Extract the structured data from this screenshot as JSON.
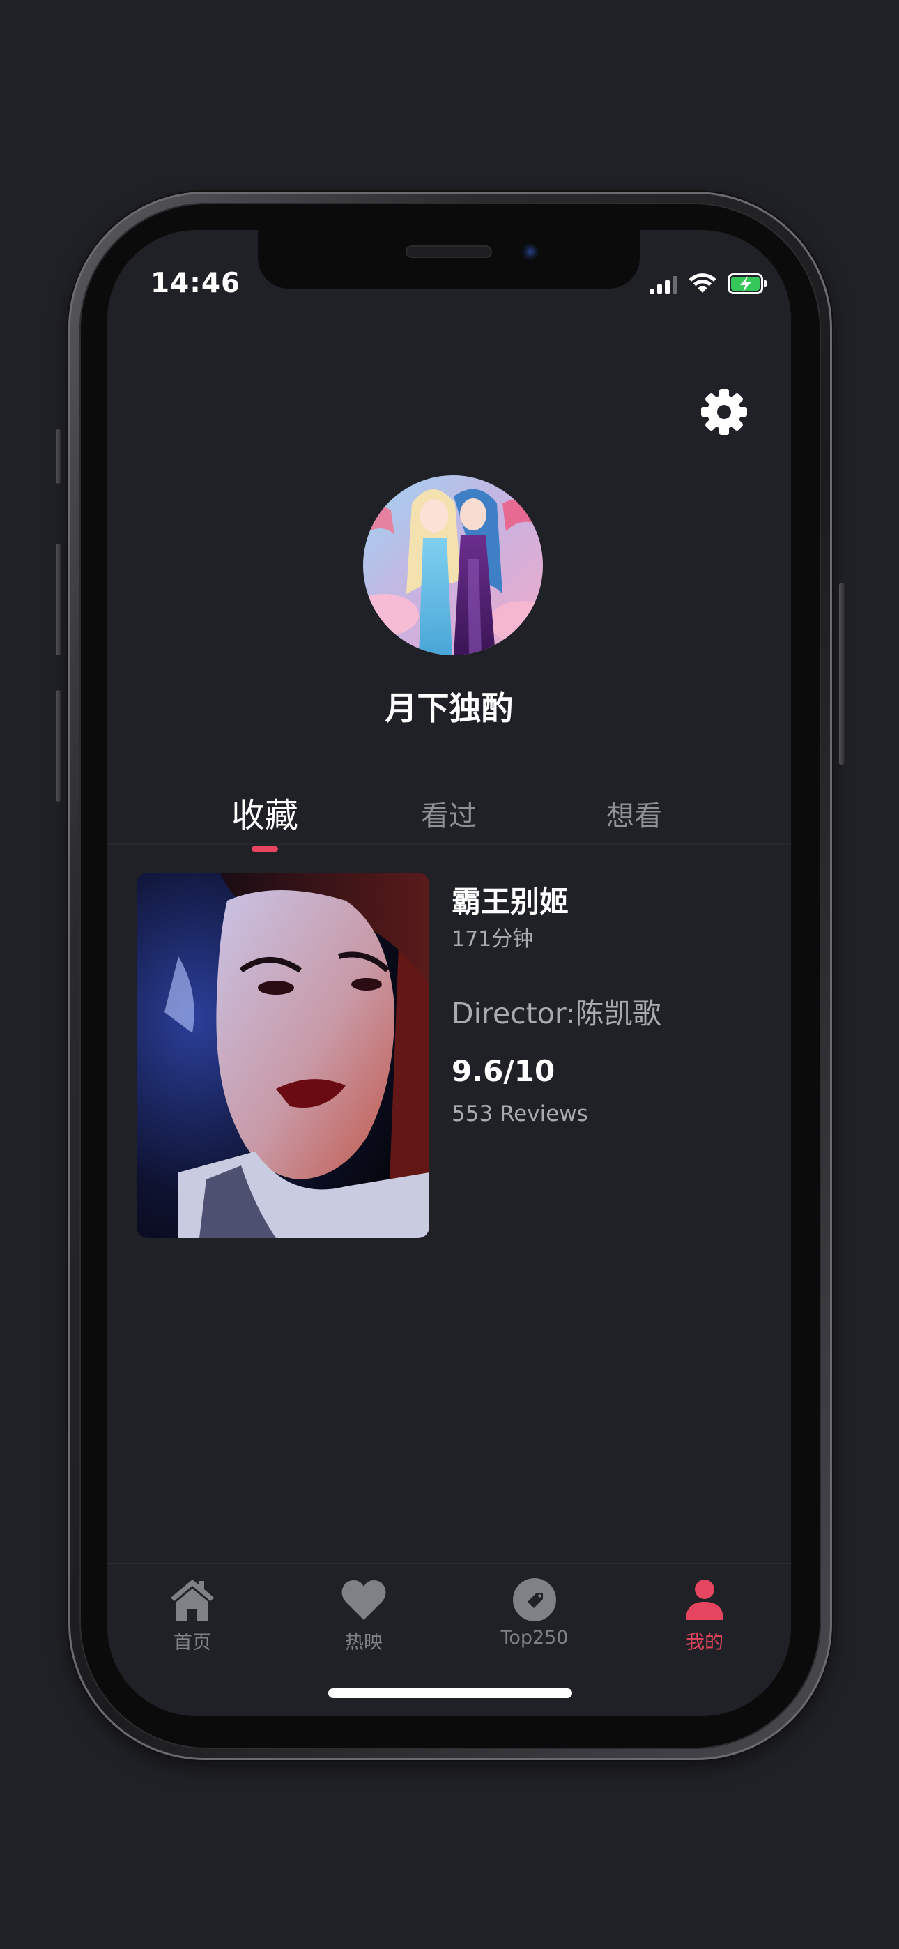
{
  "status_bar": {
    "time": "14:46",
    "icons": [
      "signal-icon",
      "wifi-icon",
      "battery-charging-icon"
    ]
  },
  "header": {
    "settings_icon": "gear-icon"
  },
  "profile": {
    "username": "月下独酌",
    "avatar": "avatar-image"
  },
  "tabs": [
    {
      "label": "收藏",
      "active": true
    },
    {
      "label": "看过",
      "active": false
    },
    {
      "label": "想看",
      "active": false
    }
  ],
  "movies": [
    {
      "title": "霸王别姬",
      "duration": "171分钟",
      "director": "Director:陈凯歌",
      "rating": "9.6/10",
      "reviews": "553 Reviews"
    }
  ],
  "bottom_nav": [
    {
      "label": "首页",
      "icon": "home-icon",
      "active": false
    },
    {
      "label": "热映",
      "icon": "heart-icon",
      "active": false
    },
    {
      "label": "Top250",
      "icon": "tag-icon",
      "active": false
    },
    {
      "label": "我的",
      "icon": "person-icon",
      "active": true
    }
  ],
  "colors": {
    "background": "#202126",
    "accent": "#e5455e",
    "text_primary": "#ffffff",
    "text_secondary": "#a9abb0",
    "inactive_icon": "#7f8186"
  }
}
